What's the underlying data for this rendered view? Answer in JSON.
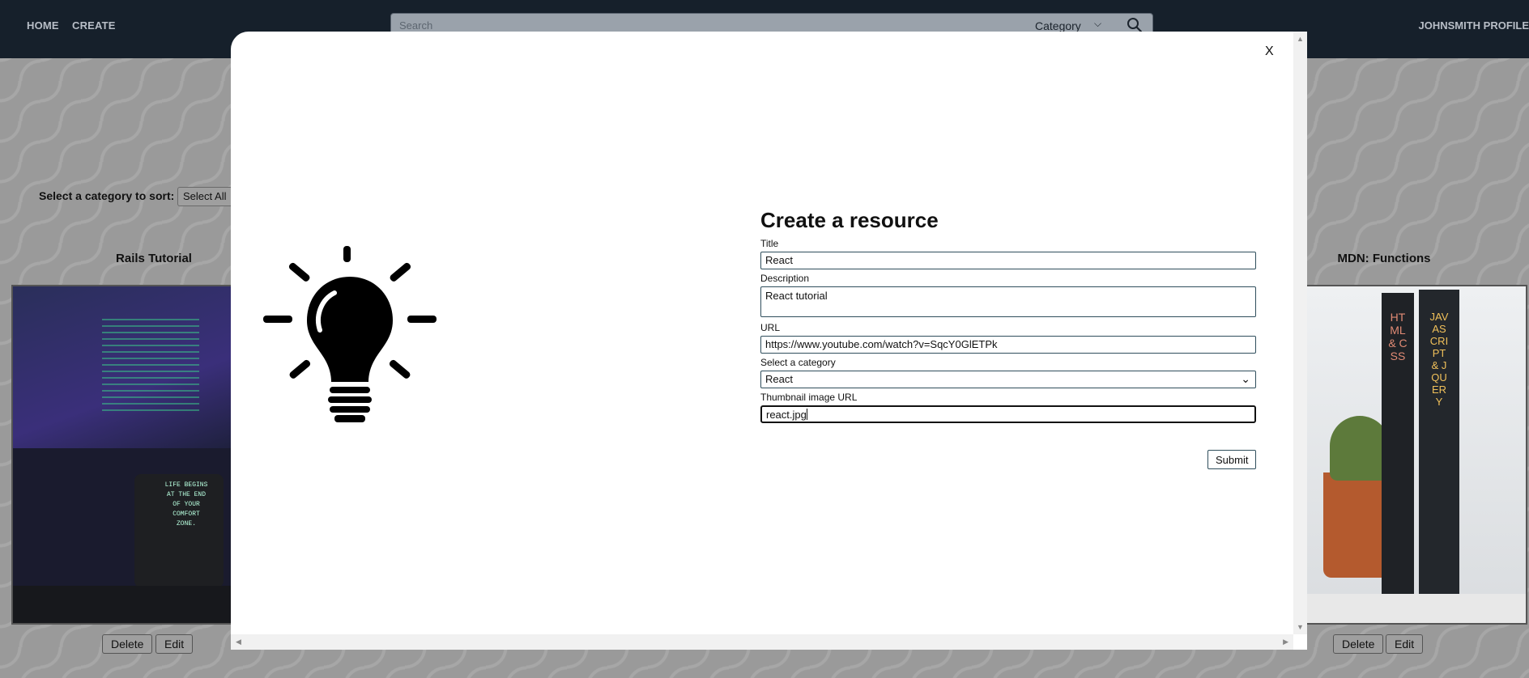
{
  "nav": {
    "home": "HOME",
    "create": "CREATE",
    "search_placeholder": "Search",
    "category": "Category",
    "profile": "JOHNSMITH PROFILE"
  },
  "page": {
    "sort_label": "Select a category to sort:",
    "sort_value": "Select All",
    "cards": [
      {
        "title": "Rails Tutorial",
        "delete": "Delete",
        "edit": "Edit"
      },
      {
        "title": "MDN: Functions",
        "delete": "Delete",
        "edit": "Edit"
      }
    ],
    "mug_text": "LIFE BEGINS AT THE END OF YOUR COMFORT ZONE.",
    "book1_title": "HTML & CSS",
    "book2_title": "JAVASCRIPT & JQUERY"
  },
  "modal": {
    "close": "X",
    "heading": "Create a resource",
    "fields": {
      "title": {
        "label": "Title",
        "value": "React"
      },
      "description": {
        "label": "Description",
        "value": "React tutorial"
      },
      "url": {
        "label": "URL",
        "value": "https://www.youtube.com/watch?v=SqcY0GlETPk"
      },
      "category": {
        "label": "Select a category",
        "value": "React"
      },
      "thumbnail": {
        "label": "Thumbnail image URL",
        "value": "react.jpg"
      }
    },
    "submit": "Submit"
  }
}
